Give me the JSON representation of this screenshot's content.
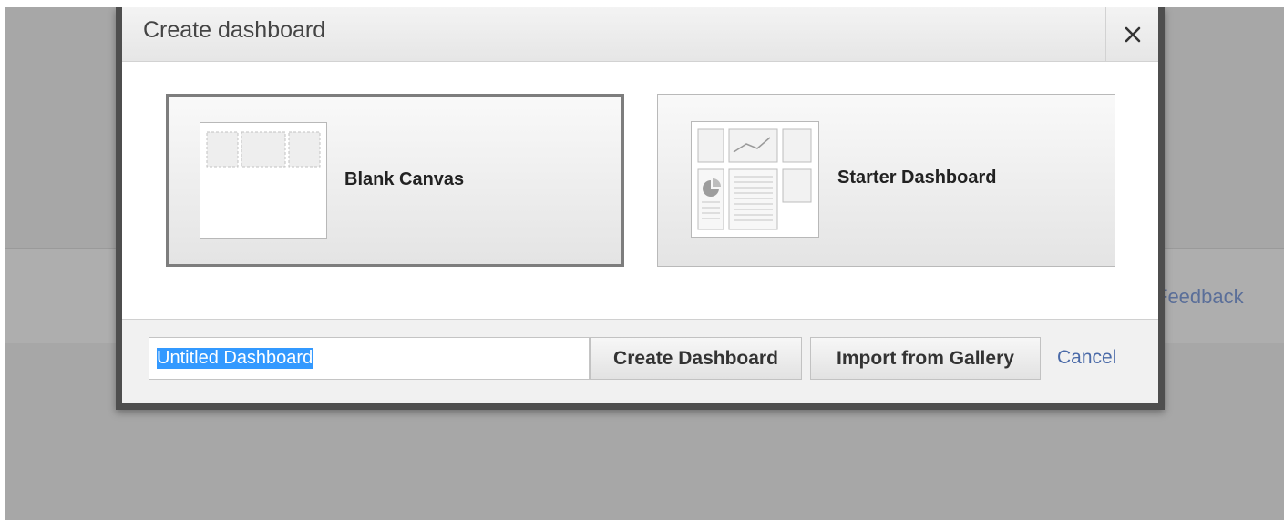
{
  "background": {
    "feedback_link": "Feedback"
  },
  "dialog": {
    "title": "Create dashboard",
    "close_icon": "close-icon",
    "options": [
      {
        "id": "blank",
        "label": "Blank Canvas",
        "icon": "blank-canvas-thumbnail-icon",
        "selected": true
      },
      {
        "id": "starter",
        "label": "Starter Dashboard",
        "icon": "starter-dashboard-thumbnail-icon",
        "selected": false
      }
    ],
    "footer": {
      "name_input_value": "Untitled Dashboard",
      "create_label": "Create Dashboard",
      "import_label": "Import from Gallery",
      "cancel_label": "Cancel"
    }
  },
  "colors": {
    "overlay": "#a7a7a7",
    "modal_border": "#4e4e4e",
    "link": "#4a6aa8",
    "selection": "#3399ff"
  }
}
